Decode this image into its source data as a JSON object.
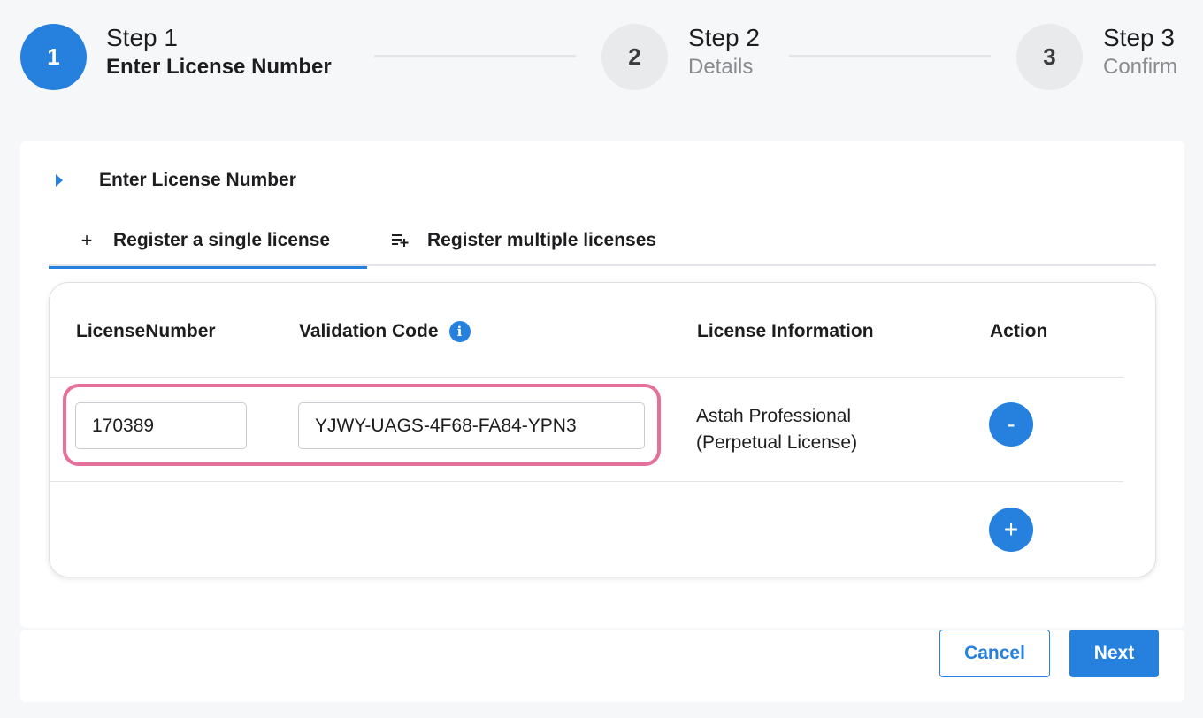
{
  "stepper": {
    "steps": [
      {
        "number": "1",
        "title": "Step 1",
        "subtitle": "Enter License Number",
        "state": "active"
      },
      {
        "number": "2",
        "title": "Step 2",
        "subtitle": "Details",
        "state": "inactive"
      },
      {
        "number": "3",
        "title": "Step 3",
        "subtitle": "Confirm",
        "state": "inactive"
      }
    ]
  },
  "section": {
    "title": "Enter License Number"
  },
  "tabs": [
    {
      "label": "Register a single license",
      "icon": "plus-icon",
      "selected": true
    },
    {
      "label": "Register multiple licenses",
      "icon": "playlist-add-icon",
      "selected": false
    }
  ],
  "table": {
    "headers": {
      "license_number": "LicenseNumber",
      "validation_code": "Validation Code",
      "license_information": "License Information",
      "action": "Action"
    },
    "rows": [
      {
        "license_number": "170389",
        "validation_code": "YJWY-UAGS-4F68-FA84-YPN3",
        "info_line1": "Astah Professional",
        "info_line2": "(Perpetual License)",
        "remove_label": "-"
      }
    ],
    "add_label": "+"
  },
  "footer": {
    "cancel_label": "Cancel",
    "next_label": "Next"
  },
  "colors": {
    "accent": "#2680de",
    "highlight": "#e5709a"
  }
}
